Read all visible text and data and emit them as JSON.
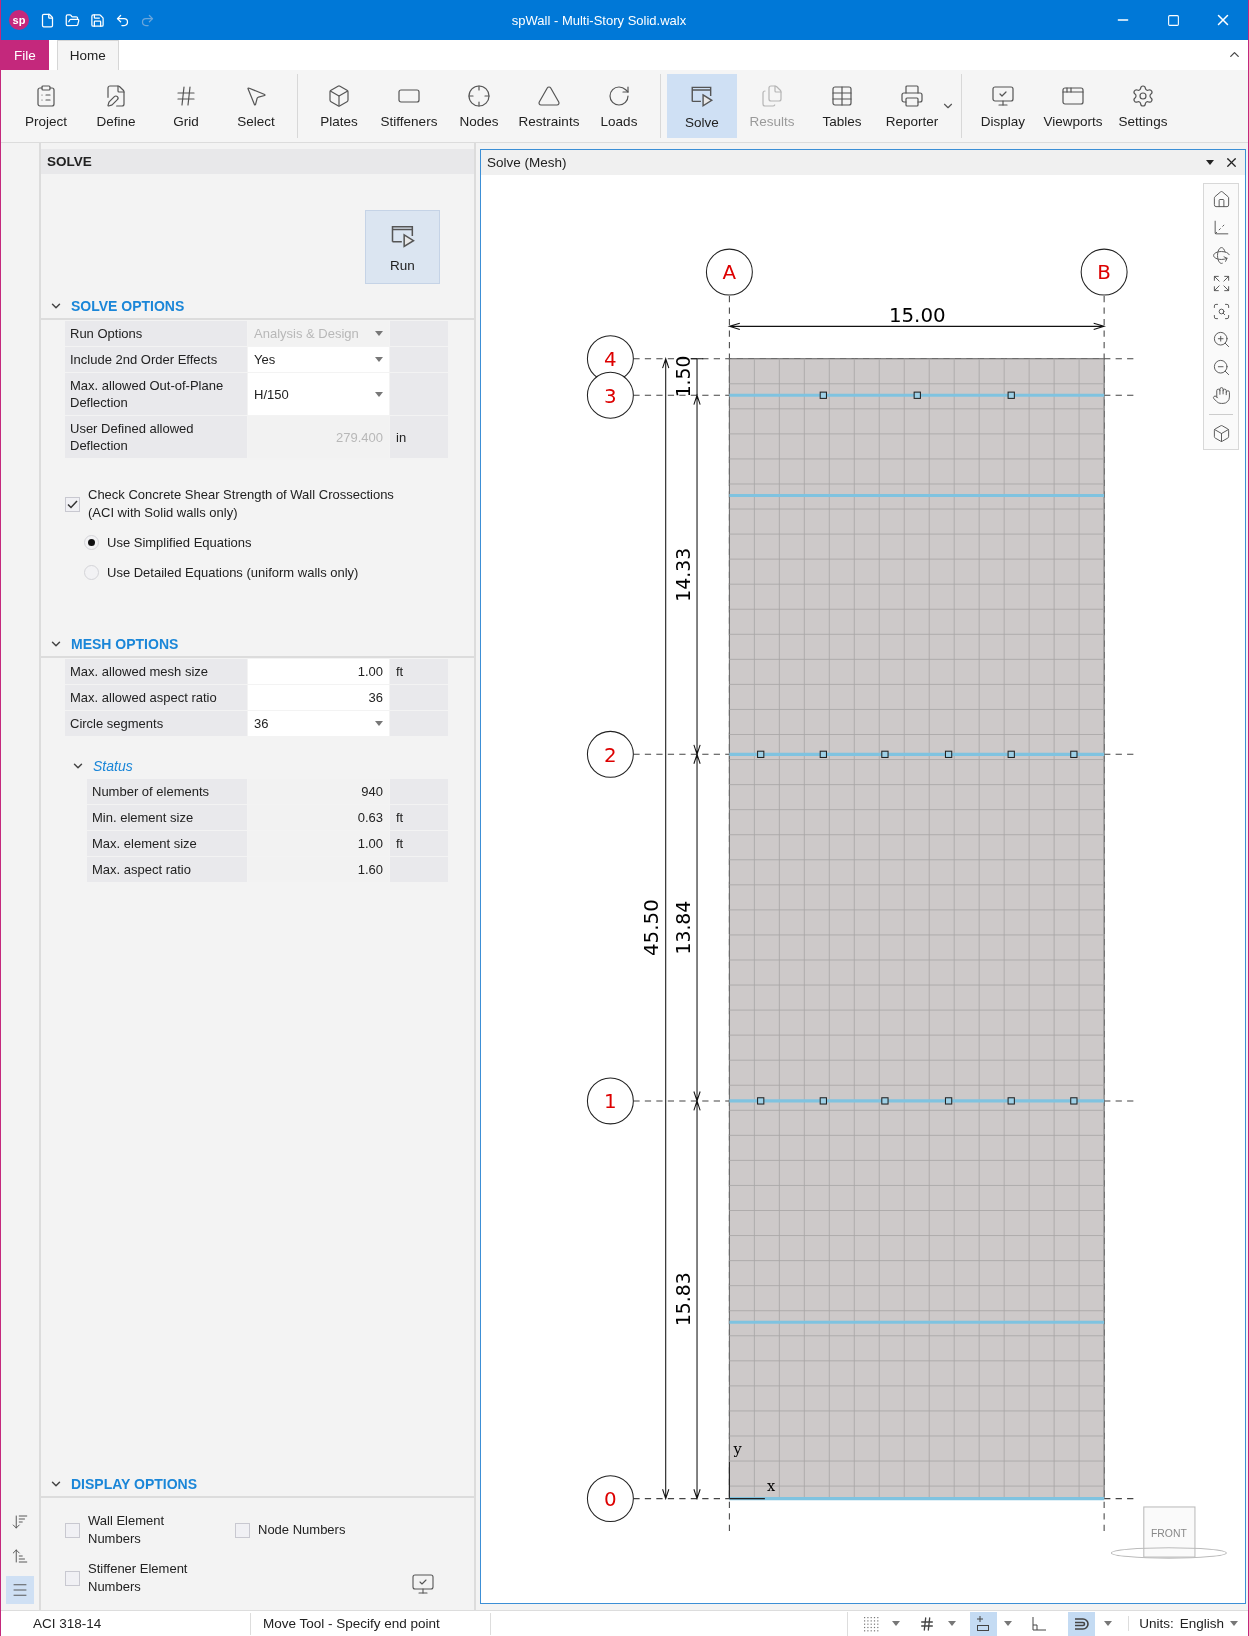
{
  "window": {
    "logo": "sp",
    "title": "spWall - Multi-Story Solid.walx",
    "quick_access": [
      {
        "kind": "new",
        "disabled": false
      },
      {
        "kind": "open",
        "disabled": false
      },
      {
        "kind": "save",
        "disabled": false
      },
      {
        "kind": "undo",
        "disabled": false
      },
      {
        "kind": "redo",
        "disabled": true
      }
    ]
  },
  "menu_tabs": [
    {
      "label": "File",
      "kind": "file",
      "selected": false
    },
    {
      "label": "Home",
      "kind": "tab",
      "selected": true
    }
  ],
  "ribbon": {
    "groups": [
      {
        "buttons": [
          {
            "label": "Project",
            "kind": "project",
            "selected": false,
            "disabled": false,
            "dropdown": false
          },
          {
            "label": "Define",
            "kind": "define",
            "selected": false,
            "disabled": false,
            "dropdown": false
          },
          {
            "label": "Grid",
            "kind": "grid",
            "selected": false,
            "disabled": false,
            "dropdown": false
          },
          {
            "label": "Select",
            "kind": "select",
            "selected": false,
            "disabled": false,
            "dropdown": false
          }
        ]
      },
      {
        "buttons": [
          {
            "label": "Plates",
            "kind": "plates",
            "selected": false,
            "disabled": false,
            "dropdown": false
          },
          {
            "label": "Stiffeners",
            "kind": "stiffeners",
            "selected": false,
            "disabled": false,
            "dropdown": false
          },
          {
            "label": "Nodes",
            "kind": "nodes",
            "selected": false,
            "disabled": false,
            "dropdown": false
          },
          {
            "label": "Restraints",
            "kind": "restraints",
            "selected": false,
            "disabled": false,
            "dropdown": false
          },
          {
            "label": "Loads",
            "kind": "loads",
            "selected": false,
            "disabled": false,
            "dropdown": false
          }
        ]
      },
      {
        "buttons": [
          {
            "label": "Solve",
            "kind": "solve",
            "selected": true,
            "disabled": false,
            "dropdown": false
          },
          {
            "label": "Results",
            "kind": "results",
            "selected": false,
            "disabled": true,
            "dropdown": false
          },
          {
            "label": "Tables",
            "kind": "tables",
            "selected": false,
            "disabled": false,
            "dropdown": false
          },
          {
            "label": "Reporter",
            "kind": "reporter",
            "selected": false,
            "disabled": false,
            "dropdown": true
          }
        ]
      },
      {
        "buttons": [
          {
            "label": "Display",
            "kind": "display",
            "selected": false,
            "disabled": false,
            "dropdown": false
          },
          {
            "label": "Viewports",
            "kind": "viewports",
            "selected": false,
            "disabled": false,
            "dropdown": false
          },
          {
            "label": "Settings",
            "kind": "settings",
            "selected": false,
            "disabled": false,
            "dropdown": false
          }
        ]
      }
    ]
  },
  "rail": [
    {
      "kind": "sort-down",
      "selected": false
    },
    {
      "kind": "sort-up",
      "selected": false
    },
    {
      "kind": "list",
      "selected": true
    }
  ],
  "panel": {
    "title": "SOLVE",
    "run_button": "Run",
    "solve_options": {
      "title": "SOLVE OPTIONS",
      "expanded": true,
      "rows": [
        {
          "label": "Run Options",
          "value": "Analysis & Design",
          "kind": "dropdown",
          "disabled": true
        },
        {
          "label": "Include 2nd Order Effects",
          "value": "Yes",
          "kind": "dropdown",
          "disabled": false
        },
        {
          "label": "Max. allowed Out-of-Plane Deflection",
          "value": "H/150",
          "kind": "dropdown",
          "disabled": false
        },
        {
          "label": "User Defined allowed Deflection",
          "value": "279.400",
          "unit": "in",
          "kind": "number",
          "disabled": true
        }
      ],
      "check": {
        "label": "Check Concrete Shear Strength of Wall Crossections (ACI with Solid walls only)",
        "checked": true
      },
      "radios": [
        {
          "label": "Use Simplified Equations",
          "selected": true
        },
        {
          "label": "Use Detailed Equations (uniform walls only)",
          "selected": false
        }
      ]
    },
    "mesh_options": {
      "title": "MESH OPTIONS",
      "expanded": true,
      "rows": [
        {
          "label": "Max. allowed mesh size",
          "value": "1.00",
          "unit": "ft",
          "kind": "number",
          "disabled": false
        },
        {
          "label": "Max. allowed aspect ratio",
          "value": "36",
          "kind": "number",
          "disabled": false
        },
        {
          "label": "Circle segments",
          "value": "36",
          "kind": "dropdown",
          "disabled": false
        }
      ],
      "status": {
        "title": "Status",
        "expanded": true,
        "rows": [
          {
            "label": "Number of elements",
            "value": "940"
          },
          {
            "label": "Min. element size",
            "value": "0.63",
            "unit": "ft"
          },
          {
            "label": "Max. element size",
            "value": "1.00",
            "unit": "ft"
          },
          {
            "label": "Max. aspect ratio",
            "value": "1.60"
          }
        ]
      }
    },
    "display_options": {
      "title": "DISPLAY OPTIONS",
      "expanded": true,
      "checks": [
        {
          "label": "Wall Element Numbers",
          "checked": false
        },
        {
          "label": "Node Numbers",
          "checked": false
        },
        {
          "label": "Stiffener Element Numbers",
          "checked": false
        }
      ]
    }
  },
  "viewport": {
    "title": "Solve (Mesh)",
    "columns": [
      {
        "label": "A"
      },
      {
        "label": "B"
      }
    ],
    "levels": [
      {
        "label": "4"
      },
      {
        "label": "3"
      },
      {
        "label": "2"
      },
      {
        "label": "1"
      },
      {
        "label": "0"
      }
    ],
    "width_dimension": "15.00",
    "height_dimension": "45.50",
    "story_dimensions": [
      "1.50",
      "14.33",
      "13.84",
      "15.83"
    ],
    "axes": {
      "x": "x",
      "y": "y"
    },
    "view_cube": "FRONT"
  },
  "status_bar": {
    "code": "ACI 318-14",
    "message": "Move Tool - Specify end point",
    "toggles": [
      {
        "kind": "dots",
        "selected": false,
        "dropdown": true
      },
      {
        "kind": "grid",
        "selected": false,
        "dropdown": true
      },
      {
        "kind": "snap",
        "selected": true,
        "dropdown": true
      },
      {
        "kind": "ortho",
        "selected": false,
        "dropdown": false
      },
      {
        "kind": "magnet",
        "selected": true,
        "dropdown": true
      }
    ],
    "units_label": "Units:",
    "units_value": "English"
  }
}
